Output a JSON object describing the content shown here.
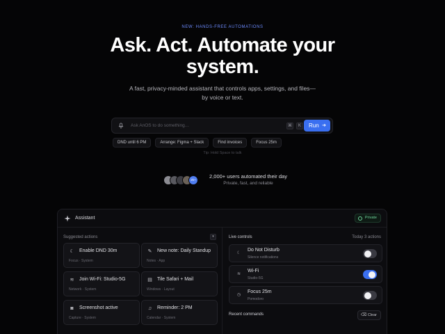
{
  "hero": {
    "eyebrow": "NEW: HANDS-FREE AUTOMATIONS",
    "title_line1": "Ask. Act. Automate your",
    "title_line2": "system.",
    "subtitle_line1": "A fast, privacy-minded assistant that controls apps, settings, and files—",
    "subtitle_line2": "by voice or text."
  },
  "command": {
    "placeholder": "Ask AnOS to do something…",
    "key1": "⌘",
    "key2": "K",
    "run_label": "Run",
    "run_icon": "arrow-right-icon"
  },
  "chips": [
    "DND until 6 PM",
    "Arrange: Figma + Slack",
    "Find invoices",
    "Focus 25m"
  ],
  "tip": "Tip: Hold Space to talk",
  "social": {
    "avatar_badge": "2k+",
    "headline": "2,000+ users automated their day",
    "sub": "Private, fast, and reliable"
  },
  "assistant": {
    "title": "Assistant",
    "private_label": "Private",
    "suggested_label": "Suggested actions",
    "suggestions": [
      {
        "title": "Enable DND 30m",
        "sub": "Focus · System",
        "icon": "moon-icon"
      },
      {
        "title": "New note: Daily Standup",
        "sub": "Notes · App",
        "icon": "note-icon"
      },
      {
        "title": "Join Wi-Fi: Studio-5G",
        "sub": "Network · System",
        "icon": "wifi-icon"
      },
      {
        "title": "Tile Safari + Mail",
        "sub": "Windows · Layout",
        "icon": "layout-icon"
      },
      {
        "title": "Screenshot active",
        "sub": "Capture · System",
        "icon": "camera-icon"
      },
      {
        "title": "Reminder: 2 PM",
        "sub": "Calendar · System",
        "icon": "bell-icon"
      }
    ],
    "live_label": "Live controls",
    "live_count": "Today 3 actions",
    "controls": [
      {
        "title": "Do Not Disturb",
        "sub": "Silence notifications",
        "on": false,
        "icon": "moon-icon"
      },
      {
        "title": "Wi-Fi",
        "sub": "Studio-5G",
        "on": true,
        "icon": "wifi-icon"
      },
      {
        "title": "Focus 25m",
        "sub": "Pomodoro",
        "on": false,
        "icon": "clock-icon"
      }
    ],
    "recent_label": "Recent commands",
    "clear_label": "Clear"
  },
  "colors": {
    "accent": "#3a6ff0",
    "success": "#6ed39a",
    "background": "#050506"
  }
}
